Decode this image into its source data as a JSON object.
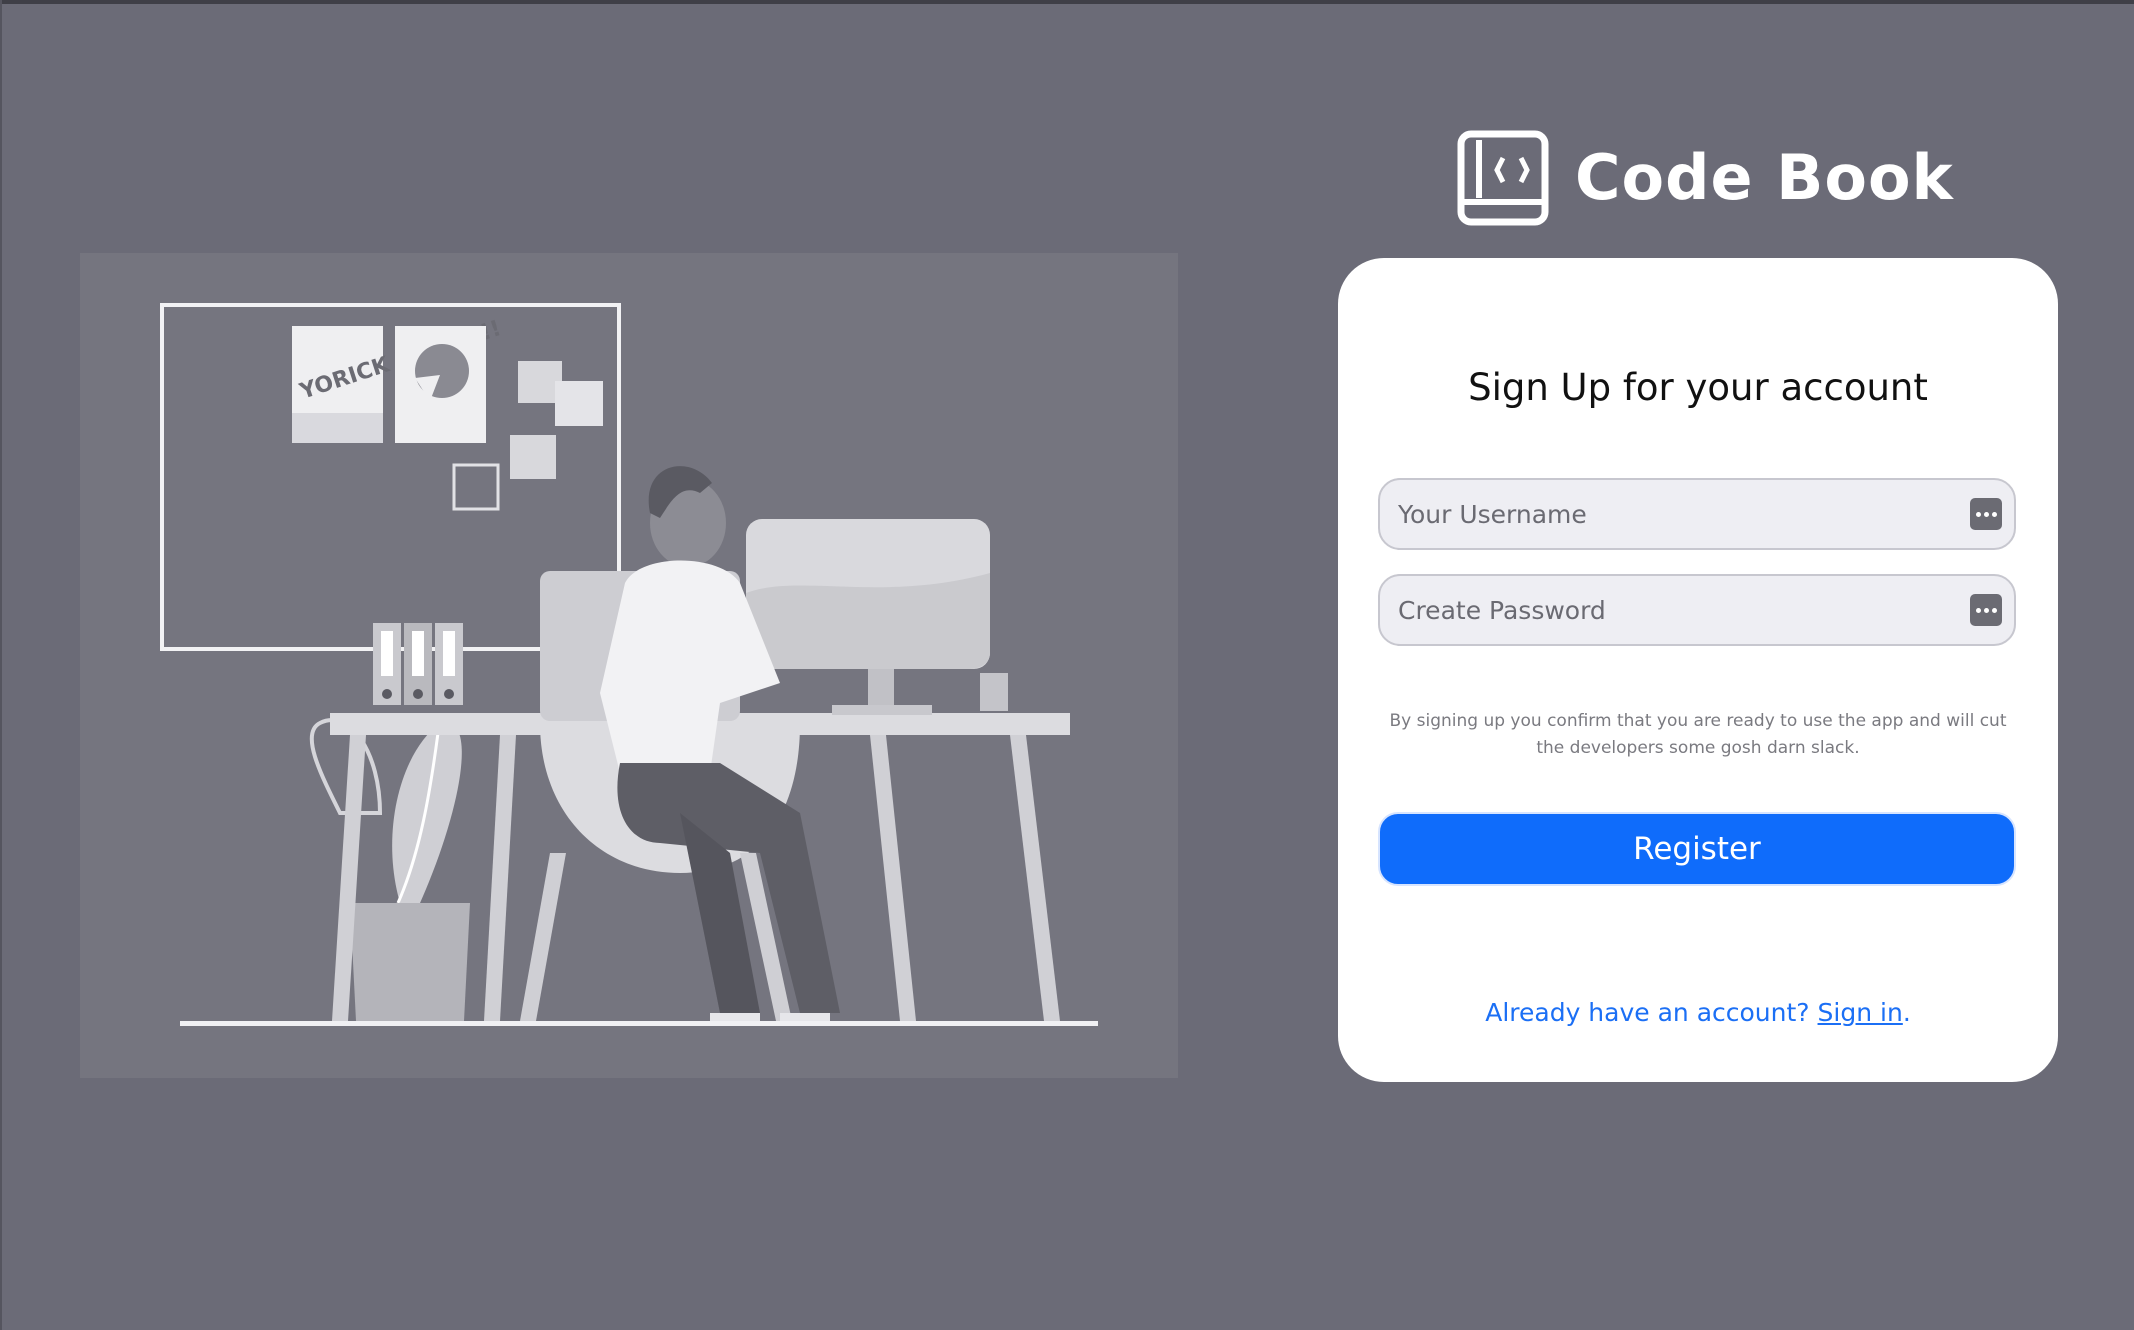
{
  "app": {
    "name": "Code Book",
    "logo_icon": "code-book-icon"
  },
  "illustration": {
    "poster_text": "YORICK RULEZ!!!"
  },
  "signup_card": {
    "title": "Sign Up for your account",
    "username_field": {
      "placeholder": "Your Username",
      "value": "",
      "icon": "password-manager-icon"
    },
    "password_field": {
      "placeholder": "Create Password",
      "value": "",
      "icon": "password-manager-icon"
    },
    "disclaimer": "By signing up you confirm that you are ready to use the app and will cut the developers some gosh darn slack.",
    "register_label": "Register",
    "signin_prompt": "Already have an account?",
    "signin_link": "Sign in",
    "signin_suffix": "."
  },
  "colors": {
    "background": "#6b6b77",
    "card": "#ffffff",
    "primary": "#0f6cfb",
    "link": "#1b6ff5"
  }
}
